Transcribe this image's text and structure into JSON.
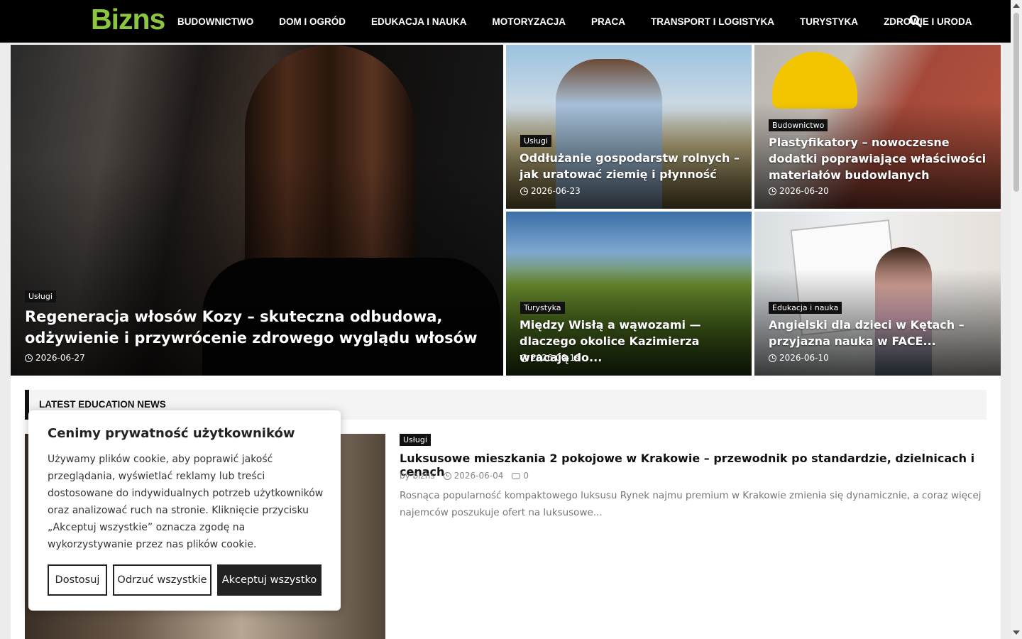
{
  "site": {
    "logo": "Bizns"
  },
  "nav": {
    "items": [
      "Budownictwo",
      "Dom i ogród",
      "Edukacja i nauka",
      "Motoryzacja",
      "Praca",
      "Transport i logistyka",
      "Turystyka",
      "Zdrowie i uroda"
    ]
  },
  "featured": [
    {
      "category": "Usługi",
      "title": "Regeneracja włosów Kozy – skuteczna odbudowa, odżywienie i przywrócenie zdrowego wyglądu włosów",
      "date": "2026-06-27"
    },
    {
      "category": "Usługi",
      "title": "Oddłużanie gospodarstw rolnych – jak uratować ziemię i płynność",
      "date": "2026-06-23"
    },
    {
      "category": "Budownictwo",
      "title": "Plastyfikatory – nowoczesne dodatki poprawiające właściwości materiałów budowlanych",
      "date": "2026-06-20"
    },
    {
      "category": "Turystyka",
      "title": "Między Wisłą a wąwozami — dlaczego okolice Kazimierza wracają do...",
      "date": "2026-06-19"
    },
    {
      "category": "Edukacja i nauka",
      "title": "Angielski dla dzieci w Kętach – przyjazna nauka w FACE...",
      "date": "2026-06-10"
    }
  ],
  "section": {
    "title": "Latest Education News"
  },
  "article": {
    "category": "Usługi",
    "title": "Luksusowe mieszkania 2 pokojowe w Krakowie – przewodnik po standardzie, dzielnicach i cenach",
    "author": "by bizns",
    "date": "2026-06-04",
    "comments": "0",
    "excerpt": "Rosnąca popularność kompaktowego luksusu Rynek najmu premium w Krakowie zmienia się dynamicznie, a coraz więcej najemców poszukuje ofert na luksusowe..."
  },
  "cookie": {
    "title": "Cenimy prywatność użytkowników",
    "text": "Używamy plików cookie, aby poprawić jakość przeglądania, wyświetlać reklamy lub treści dostosowane do indywidualnych potrzeb użytkowników oraz analizować ruch na stronie. Kliknięcie przycisku „Akceptuj wszystkie” oznacza zgodę na wykorzystywanie przez nas plików cookie.",
    "customize": "Dostosuj",
    "reject": "Odrzuć wszystkie",
    "accept": "Akceptuj wszystko"
  },
  "colors": {
    "brand": "#8cc63f",
    "nav_bg": "#000000"
  }
}
